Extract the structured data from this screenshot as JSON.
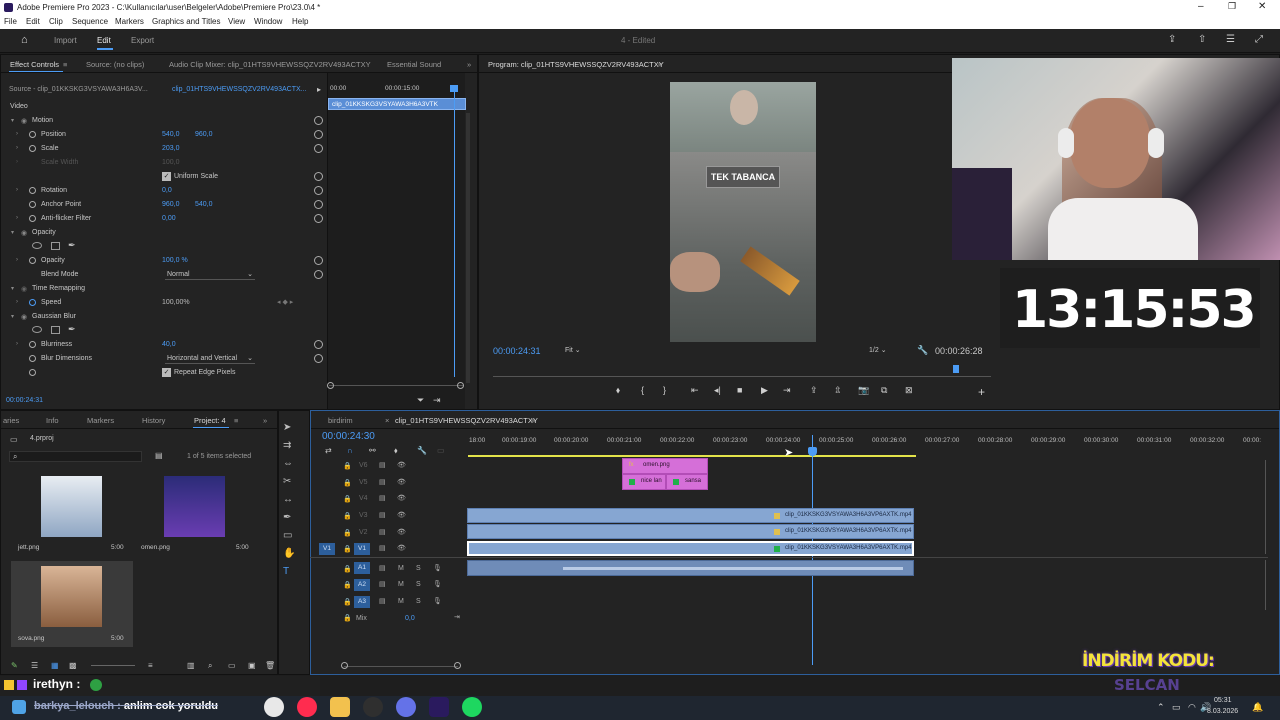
{
  "window": {
    "title": "Adobe Premiere Pro 2023 - C:\\Kullanıcılar\\user\\Belgeler\\Adobe\\Premiere Pro\\23.0\\4 *"
  },
  "menu": [
    "File",
    "Edit",
    "Clip",
    "Sequence",
    "Markers",
    "Graphics and Titles",
    "View",
    "Window",
    "Help"
  ],
  "header": {
    "tabs": [
      "Import",
      "Edit",
      "Export"
    ],
    "project_title": "4 - Edited"
  },
  "effect_controls": {
    "tabs": [
      "Effect Controls",
      "Source: (no clips)",
      "Audio Clip Mixer: clip_01HTS9VHEWSSQZV2RV493ACTXY",
      "Essential Sound"
    ],
    "source_label": "Source - clip_01KKSKG3VSYAWA3H6A3V...",
    "clip_label": "clip_01HTS9VHEWSSQZV2RV493ACTX...",
    "mini_ruler": [
      "00:00",
      "00:00:15:00"
    ],
    "mini_clip": "clip_01KKSKG3VSYAWA3H6A3VTK",
    "section": "Video",
    "rows": {
      "motion": "Motion",
      "position": "Position",
      "position_x": "540,0",
      "position_y": "960,0",
      "scale": "Scale",
      "scale_val": "203,0",
      "scale_width": "Scale Width",
      "scale_width_val": "100,0",
      "uniform_scale": "Uniform Scale",
      "rotation": "Rotation",
      "rotation_val": "0,0",
      "anchor": "Anchor Point",
      "anchor_x": "960,0",
      "anchor_y": "540,0",
      "antiflicker": "Anti-flicker Filter",
      "antiflicker_val": "0,00",
      "opacity": "Opacity",
      "opacity_sub": "Opacity",
      "opacity_val": "100,0 %",
      "blend_mode": "Blend Mode",
      "blend_val": "Normal",
      "time_remap": "Time Remapping",
      "speed": "Speed",
      "speed_val": "100,00%",
      "gaussian": "Gaussian Blur",
      "blurriness": "Blurriness",
      "blurriness_val": "40,0",
      "blur_dim": "Blur Dimensions",
      "blur_dim_val": "Horizontal and Vertical",
      "repeat_edge": "Repeat Edge Pixels"
    },
    "timecode": "00:00:24:31"
  },
  "program": {
    "title": "Program: clip_01HTS9VHEWSSQZV2RV493ACTXY",
    "overlay_text": "TEK TABANCA",
    "timecode": "00:00:24:31",
    "fit": "Fit",
    "resolution": "1/2",
    "duration": "00:00:26:28"
  },
  "project": {
    "tabs": [
      "aries",
      "Info",
      "Markers",
      "History",
      "Project: 4"
    ],
    "file": "4.prproj",
    "selection": "1 of 5 items selected",
    "items": [
      {
        "name": "jett.png",
        "duration": "5:00"
      },
      {
        "name": "omen.png",
        "duration": "5:00"
      },
      {
        "name": "sova.png",
        "duration": "5:00"
      }
    ]
  },
  "timeline": {
    "tabs": [
      "birdirim",
      "clip_01HTS9VHEWSSQZV2RV493ACTXY"
    ],
    "timecode": "00:00:24:30",
    "ruler": [
      "18:00",
      "00:00:19:00",
      "00:00:20:00",
      "00:00:21:00",
      "00:00:22:00",
      "00:00:23:00",
      "00:00:24:00",
      "00:00:25:00",
      "00:00:26:00",
      "00:00:27:00",
      "00:00:28:00",
      "00:00:29:00",
      "00:00:30:00",
      "00:00:31:00",
      "00:00:32:00",
      "00:00:"
    ],
    "video_tracks": [
      "V6",
      "V5",
      "V4",
      "V3",
      "V2",
      "V1"
    ],
    "audio_tracks": [
      "A1",
      "A2",
      "A3"
    ],
    "mix_label": "Mix",
    "mix_val": "0,0",
    "clips": {
      "omen": "omen.png",
      "nice": "nice lan",
      "sansa": "sansa",
      "v3": "clip_01KKSKG3VSYAWA3H6A3VP6AXTK.mp4",
      "v2": "clip_01KKSKG3VSYAWA3H6A3VP6AXTK.mp4",
      "v1": "clip_01KKSKG3VSYAWA3H6A3VP6AXTK.mp4"
    }
  },
  "overlay": {
    "clock": "13:15:53",
    "discount_label": "İNDİRİM KODU:",
    "discount_code": "SELCAN",
    "chat_user": "irethyn :",
    "chat_msg_user": "barkya_lelouch :",
    "chat_msg": "anlim cok yoruldu"
  },
  "taskbar": {
    "time": "05:31",
    "date": "8.03.2026"
  },
  "colors": {
    "accent": "#4c9cf5",
    "clip_pink": "#d56fd8",
    "clip_blue": "#86a6d2",
    "work_area": "#e3e34a",
    "discount": "#f4e33a"
  }
}
